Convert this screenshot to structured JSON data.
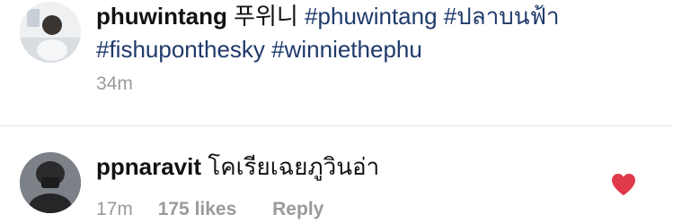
{
  "post": {
    "username": "phuwintang",
    "caption_text": "푸위니",
    "hashtags": [
      "#phuwintang",
      "#ปลาบนฟ้า",
      "#fishuponthesky",
      "#winniethephu"
    ],
    "time_ago": "34m"
  },
  "comment": {
    "username": "ppnaravit",
    "text": "โคเรียเฉยภูวินอ่า",
    "time_ago": "17m",
    "likes": "175 likes",
    "reply_label": "Reply",
    "liked": true,
    "heart_color": "#e0394a"
  },
  "colors": {
    "hashtag": "#1f3a6b",
    "meta_text": "#9a9a9a"
  }
}
